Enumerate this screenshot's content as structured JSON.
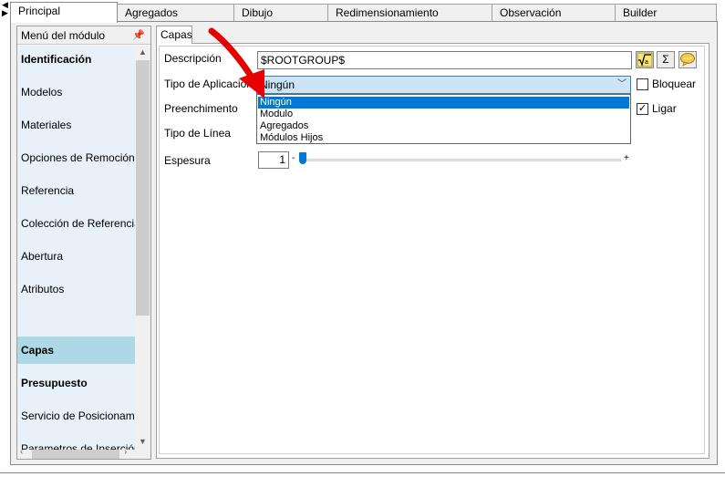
{
  "top_tabs": [
    {
      "label": "Principal",
      "active": true
    },
    {
      "label": "Agregados",
      "active": false
    },
    {
      "label": "Dibujo",
      "active": false
    },
    {
      "label": "Redimensionamiento",
      "active": false
    },
    {
      "label": "Observación",
      "active": false
    },
    {
      "label": "Builder",
      "active": false
    }
  ],
  "side_menu": {
    "title": "Menú del módulo",
    "pin_icon": "pin-icon",
    "items": [
      {
        "label": "Identificación",
        "bold": true,
        "selected": false
      },
      {
        "label": "Modelos",
        "bold": false,
        "selected": false
      },
      {
        "label": "Materiales",
        "bold": false,
        "selected": false
      },
      {
        "label": "Opciones de Remoción",
        "bold": false,
        "selected": false
      },
      {
        "label": "Referencia",
        "bold": false,
        "selected": false
      },
      {
        "label": "Colección de Referencias",
        "bold": false,
        "selected": false
      },
      {
        "label": "Abertura",
        "bold": false,
        "selected": false
      },
      {
        "label": "Atributos",
        "bold": false,
        "selected": false
      },
      {
        "label": "Capas",
        "bold": true,
        "selected": true
      },
      {
        "label": "Presupuesto",
        "bold": true,
        "selected": false
      },
      {
        "label": "Servicio de Posicionamiento",
        "bold": false,
        "selected": false
      },
      {
        "label": "Parametros de Inserción",
        "bold": false,
        "selected": false
      }
    ]
  },
  "inner_tab": {
    "label": "Capas"
  },
  "form": {
    "descripcion_label": "Descripción",
    "descripcion_value": "$ROOTGROUP$",
    "tipo_aplicacion_label": "Tipo de Aplicación",
    "tipo_aplicacion_value": "Ningún",
    "tipo_aplicacion_options": [
      "Ningún",
      "Modulo",
      "Agregados",
      "Módulos Hijos"
    ],
    "preenchimento_label": "Preenchimento",
    "tipo_linea_label": "Tipo de Línea",
    "espesura_label": "Espesura",
    "espesura_value": "1",
    "espesura_minus": "-",
    "espesura_plus": "+",
    "bloquear_label": "Bloquear",
    "bloquear_checked": false,
    "ligar_label": "Ligar",
    "ligar_checked": true,
    "sigma_button": "Σ"
  },
  "colors": {
    "selected_menu": "#add8e6",
    "dropdown_selection": "#0078d7",
    "annotation_arrow": "#e60000"
  }
}
